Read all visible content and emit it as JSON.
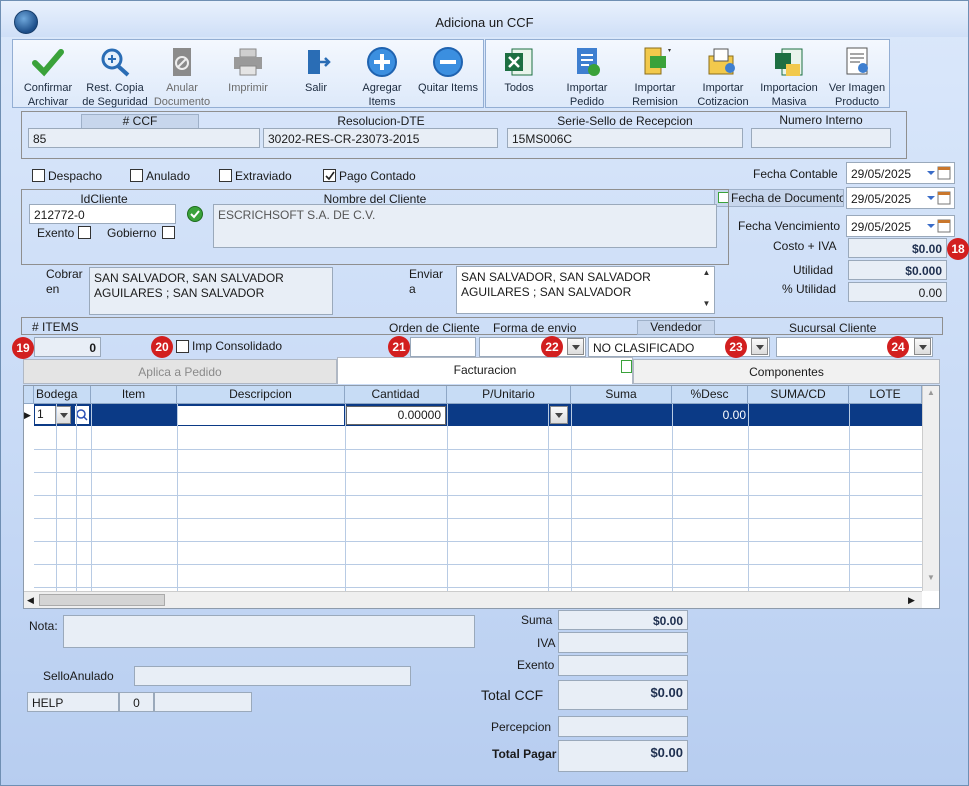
{
  "window": {
    "title": "Adiciona un CCF"
  },
  "toolbar": {
    "confirm": "Confirmar Archivar",
    "restore": "Rest. Copia de Seguridad",
    "cancel_doc": "Anular Documento",
    "print": "Imprimir",
    "exit": "Salir",
    "add_items": "Agregar Items",
    "remove_items": "Quitar Items",
    "all": "Todos",
    "import_order": "Importar Pedido",
    "import_remission": "Importar Remision",
    "import_quote": "Importar Cotizacion",
    "import_mass": "Importacion Masiva",
    "view_image": "Ver Imagen Producto"
  },
  "header": {
    "ccf_label": "# CCF",
    "ccf_value": "85",
    "resolution_label": "Resolucion-DTE",
    "resolution_value": "30202-RES-CR-23073-2015",
    "serie_label": "Serie-Sello de Recepcion",
    "serie_value": "15MS006C",
    "internal_label": "Numero Interno",
    "internal_value": ""
  },
  "flags": {
    "despacho": "Despacho",
    "anulado": "Anulado",
    "extraviado": "Extraviado",
    "pago_contado": "Pago Contado"
  },
  "dates": {
    "contable_label": "Fecha Contable",
    "contable": "29/05/2025",
    "documento_label": "Fecha de Documento",
    "documento": "29/05/2025",
    "vencimiento_label": "Fecha Vencimiento",
    "vencimiento": "29/05/2025"
  },
  "client": {
    "id_label": "IdCliente",
    "id_value": "212772-0",
    "name_label": "Nombre del Cliente",
    "name_value": "ESCRICHSOFT S.A. DE C.V.",
    "exento": "Exento",
    "gobierno": "Gobierno"
  },
  "costs": {
    "costo_iva_label": "Costo + IVA",
    "costo_iva": "$0.00",
    "utilidad_label": "Utilidad",
    "utilidad": "$0.000",
    "pct_label": "% Utilidad",
    "pct": "0.00"
  },
  "address": {
    "cobrar_label": "Cobrar en",
    "cobrar": "SAN SALVADOR, SAN SALVADOR AGUILARES ; SAN SALVADOR",
    "enviar_label": "Enviar a",
    "enviar": "SAN SALVADOR, SAN SALVADOR AGUILARES ; SAN SALVADOR"
  },
  "info": {
    "items_label": "# ITEMS",
    "items": "0",
    "consolidado": "Imp Consolidado",
    "orden_label": "Orden de Cliente",
    "orden": "",
    "envio_label": "Forma de envio",
    "envio": "",
    "vendedor_label": "Vendedor",
    "vendedor": "NO CLASIFICADO",
    "sucursal_label": "Sucursal Cliente",
    "sucursal": ""
  },
  "badges": {
    "b18": "18",
    "b19": "19",
    "b20": "20",
    "b21": "21",
    "b22": "22",
    "b23": "23",
    "b24": "24"
  },
  "tabs": {
    "pedido": "Aplica a Pedido",
    "facturacion": "Facturacion",
    "componentes": "Componentes"
  },
  "grid": {
    "columns": [
      "Bodega",
      "Item",
      "Descripcion",
      "Cantidad",
      "P/Unitario",
      "Suma",
      "%Desc",
      "SUMA/CD",
      "LOTE"
    ],
    "row": {
      "bodega": "1",
      "cantidad": "0.00000",
      "desc": "0.00"
    }
  },
  "footer": {
    "nota_label": "Nota:",
    "sello_label": "SelloAnulado",
    "help": "HELP",
    "help_num": "0",
    "suma_label": "Suma",
    "suma": "$0.00",
    "iva_label": "IVA",
    "exento_label": "Exento",
    "total_ccf_label": "Total CCF",
    "total_ccf": "$0.00",
    "percepcion_label": "Percepcion",
    "total_pagar_label": "Total Pagar",
    "total_pagar": "$0.00"
  }
}
